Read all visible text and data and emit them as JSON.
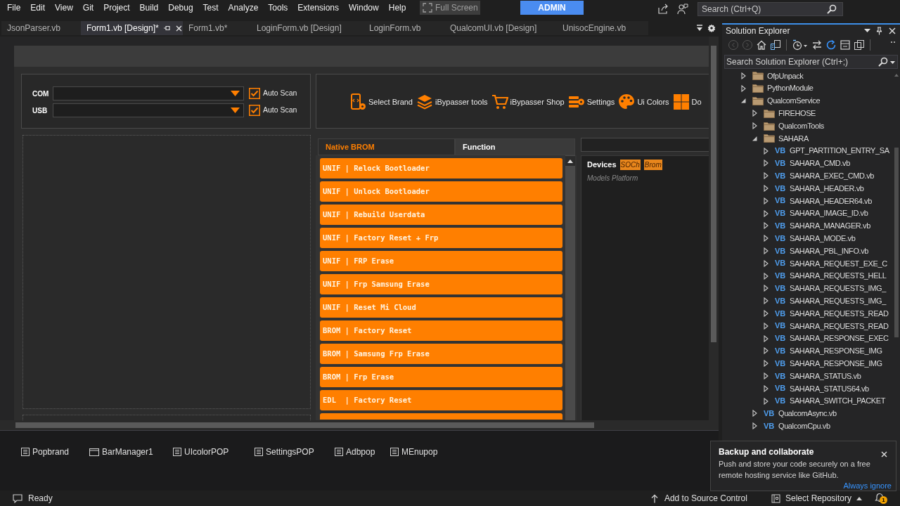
{
  "menu_bar": {
    "items": [
      "File",
      "Edit",
      "View",
      "Git",
      "Project",
      "Build",
      "Debug",
      "Test",
      "Analyze",
      "Tools",
      "Extensions",
      "Window",
      "Help"
    ],
    "full_screen": "Full Screen",
    "badge": "ADMIN",
    "search": {
      "placeholder": "Search (Ctrl+Q)"
    }
  },
  "editor_tabs": [
    {
      "label": "JsonParser.vb",
      "selected": false
    },
    {
      "label": "Form1.vb [Design]*",
      "selected": true
    },
    {
      "label": "Form1.vb*",
      "selected": false
    },
    {
      "label": "LoginForm.vb [Design]",
      "selected": false
    },
    {
      "label": "LoginForm.vb",
      "selected": false
    },
    {
      "label": "QualcomUI.vb [Design]",
      "selected": false
    },
    {
      "label": "UnisocEngine.vb",
      "selected": false
    }
  ],
  "form": {
    "ports": [
      {
        "label": "COM",
        "checkbox": {
          "label": "Auto Scan",
          "checked": true
        }
      },
      {
        "label": "USB",
        "checkbox": {
          "label": "Auto Scan",
          "checked": true
        }
      }
    ],
    "toolbar": [
      {
        "kind": "phone",
        "label": "Select Brand"
      },
      {
        "kind": "layers",
        "label": "iBypasser tools"
      },
      {
        "kind": "cart",
        "label": "iBypasser Shop"
      },
      {
        "kind": "server",
        "label": "Settings"
      },
      {
        "kind": "palette",
        "label": "Ui Colors"
      },
      {
        "kind": "grid",
        "label": "Do"
      }
    ],
    "tabs": [
      {
        "label": "Native BROM",
        "selected": true
      },
      {
        "label": "Function",
        "selected": false
      }
    ],
    "actions": [
      "UNIF | Relock Bootloader",
      "UNIF | Unlock Bootloader",
      "UNIF | Rebuild Userdata",
      "UNIF | Factory Reset + Frp",
      "UNIF | FRP Erase",
      "UNIF | Frp Samsung Erase",
      "UNIF | Reset Mi Cloud",
      "BROM | Factory Reset",
      "BROM | Samsung Frp Erase",
      "BROM | Frp Erase",
      "EDL  | Factory Reset"
    ],
    "devices": {
      "title": "Devices",
      "tags": [
        "SOCh",
        "Brom"
      ],
      "subtitle": "Models Platform"
    }
  },
  "component_tray": [
    {
      "kind": "popup",
      "label": "Popbrand"
    },
    {
      "kind": "manager",
      "label": "BarManager1"
    },
    {
      "kind": "popup",
      "label": "UIcolorPOP"
    },
    {
      "kind": "popup",
      "label": "SettingsPOP"
    },
    {
      "kind": "popup",
      "label": "Adbpop"
    },
    {
      "kind": "popup",
      "label": "MEnupop"
    }
  ],
  "solution_explorer": {
    "title": "Solution Explorer",
    "tools": [
      {
        "kind": "back",
        "disabled": true
      },
      {
        "kind": "forward",
        "disabled": true
      },
      {
        "kind": "home",
        "disabled": false
      },
      {
        "kind": "switch_views",
        "disabled": false
      },
      {
        "kind": "history",
        "disabled": false
      },
      {
        "kind": "sync",
        "disabled": false
      },
      {
        "kind": "refresh",
        "disabled": false
      },
      {
        "kind": "collapse_all",
        "disabled": false
      },
      {
        "kind": "show_all",
        "disabled": false
      }
    ],
    "search": {
      "placeholder": "Search Solution Explorer (Ctrl+;)"
    },
    "tree": [
      {
        "label": "OfpUnpack",
        "kind": "folder",
        "expanded": false
      },
      {
        "label": "PythonModule",
        "kind": "folder",
        "expanded": false
      },
      {
        "label": "QualcomService",
        "kind": "folder",
        "expanded": true,
        "children": [
          {
            "label": "FIREHOSE",
            "kind": "folder",
            "expanded": false
          },
          {
            "label": "QualcomTools",
            "kind": "folder",
            "expanded": false
          },
          {
            "label": "SAHARA",
            "kind": "folder",
            "expanded": true,
            "children": [
              {
                "label": "GPT_PARTITION_ENTRY_SA",
                "kind": "file",
                "icon_text": "VB",
                "expanded": false
              },
              {
                "label": "SAHARA_CMD.vb",
                "kind": "file",
                "icon_text": "VB",
                "expanded": false
              },
              {
                "label": "SAHARA_EXEC_CMD.vb",
                "kind": "file",
                "icon_text": "VB",
                "expanded": false
              },
              {
                "label": "SAHARA_HEADER.vb",
                "kind": "file",
                "icon_text": "VB",
                "expanded": false
              },
              {
                "label": "SAHARA_HEADER64.vb",
                "kind": "file",
                "icon_text": "VB",
                "expanded": false
              },
              {
                "label": "SAHARA_IMAGE_ID.vb",
                "kind": "file",
                "icon_text": "VB",
                "expanded": false
              },
              {
                "label": "SAHARA_MANAGER.vb",
                "kind": "file",
                "icon_text": "VB",
                "expanded": false
              },
              {
                "label": "SAHARA_MODE.vb",
                "kind": "file",
                "icon_text": "VB",
                "expanded": false
              },
              {
                "label": "SAHARA_PBL_INFO.vb",
                "kind": "file",
                "icon_text": "VB",
                "expanded": false
              },
              {
                "label": "SAHARA_REQUEST_EXE_C",
                "kind": "file",
                "icon_text": "VB",
                "expanded": false
              },
              {
                "label": "SAHARA_REQUESTS_HELL",
                "kind": "file",
                "icon_text": "VB",
                "expanded": false
              },
              {
                "label": "SAHARA_REQUESTS_IMG_",
                "kind": "file",
                "icon_text": "VB",
                "expanded": false
              },
              {
                "label": "SAHARA_REQUESTS_IMG_",
                "kind": "file",
                "icon_text": "VB",
                "expanded": false
              },
              {
                "label": "SAHARA_REQUESTS_READ",
                "kind": "file",
                "icon_text": "VB",
                "expanded": false
              },
              {
                "label": "SAHARA_REQUESTS_READ",
                "kind": "file",
                "icon_text": "VB",
                "expanded": false
              },
              {
                "label": "SAHARA_RESPONSE_EXEC",
                "kind": "file",
                "icon_text": "VB",
                "expanded": false
              },
              {
                "label": "SAHARA_RESPONSE_IMG",
                "kind": "file",
                "icon_text": "VB",
                "expanded": false
              },
              {
                "label": "SAHARA_RESPONSE_IMG",
                "kind": "file",
                "icon_text": "VB",
                "expanded": false
              },
              {
                "label": "SAHARA_STATUS.vb",
                "kind": "file",
                "icon_text": "VB",
                "expanded": false
              },
              {
                "label": "SAHARA_STATUS64.vb",
                "kind": "file",
                "icon_text": "VB",
                "expanded": false
              },
              {
                "label": "SAHARA_SWITCH_PACKET",
                "kind": "file",
                "icon_text": "VB",
                "expanded": false
              }
            ]
          },
          {
            "label": "QualcomAsync.vb",
            "kind": "file",
            "icon_text": "VB",
            "expanded": false
          },
          {
            "label": "QualcomCpu.vb",
            "kind": "file",
            "icon_text": "VB",
            "expanded": false
          }
        ]
      }
    ]
  },
  "notification": {
    "title": "Backup and collaborate",
    "message": "Push and store your code securely on a free remote hosting service like GitHub.",
    "link": "Always ignore"
  },
  "status_bar": {
    "status": "Ready",
    "source_control": "Add to Source Control",
    "repository": "Select Repository",
    "alerts": "1"
  }
}
